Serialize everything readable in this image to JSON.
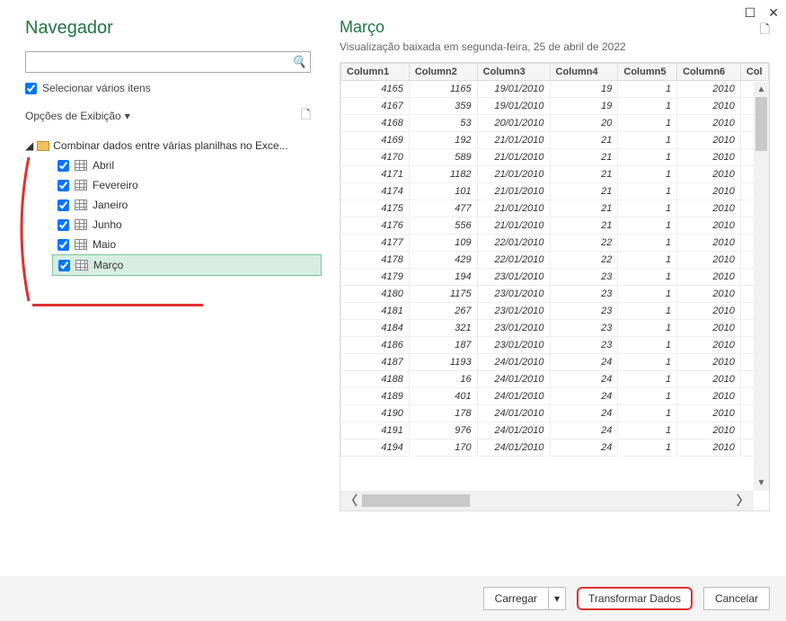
{
  "window": {
    "title": "Navegador"
  },
  "search": {
    "placeholder": ""
  },
  "selectMultiple": {
    "label": "Selecionar vários itens",
    "checked": true
  },
  "displayOptions": {
    "label": "Opções de Exibição"
  },
  "tree": {
    "root": "Combinar dados entre várias planilhas no Exce...",
    "items": [
      {
        "label": "Abril",
        "checked": true,
        "selected": false
      },
      {
        "label": "Fevereiro",
        "checked": true,
        "selected": false
      },
      {
        "label": "Janeiro",
        "checked": true,
        "selected": false
      },
      {
        "label": "Junho",
        "checked": true,
        "selected": false
      },
      {
        "label": "Maio",
        "checked": true,
        "selected": false
      },
      {
        "label": "Março",
        "checked": true,
        "selected": true
      }
    ]
  },
  "preview": {
    "title": "Março",
    "subtitle": "Visualização baixada em segunda-feira, 25 de abril de 2022",
    "columns": [
      "Column1",
      "Column2",
      "Column3",
      "Column4",
      "Column5",
      "Column6",
      "Col"
    ],
    "rows": [
      [
        "4165",
        "1165",
        "19/01/2010",
        "19",
        "1",
        "2010"
      ],
      [
        "4167",
        "359",
        "19/01/2010",
        "19",
        "1",
        "2010"
      ],
      [
        "4168",
        "53",
        "20/01/2010",
        "20",
        "1",
        "2010"
      ],
      [
        "4169",
        "192",
        "21/01/2010",
        "21",
        "1",
        "2010"
      ],
      [
        "4170",
        "589",
        "21/01/2010",
        "21",
        "1",
        "2010"
      ],
      [
        "4171",
        "1182",
        "21/01/2010",
        "21",
        "1",
        "2010"
      ],
      [
        "4174",
        "101",
        "21/01/2010",
        "21",
        "1",
        "2010"
      ],
      [
        "4175",
        "477",
        "21/01/2010",
        "21",
        "1",
        "2010"
      ],
      [
        "4176",
        "556",
        "21/01/2010",
        "21",
        "1",
        "2010"
      ],
      [
        "4177",
        "109",
        "22/01/2010",
        "22",
        "1",
        "2010"
      ],
      [
        "4178",
        "429",
        "22/01/2010",
        "22",
        "1",
        "2010"
      ],
      [
        "4179",
        "194",
        "23/01/2010",
        "23",
        "1",
        "2010"
      ],
      [
        "4180",
        "1175",
        "23/01/2010",
        "23",
        "1",
        "2010"
      ],
      [
        "4181",
        "267",
        "23/01/2010",
        "23",
        "1",
        "2010"
      ],
      [
        "4184",
        "321",
        "23/01/2010",
        "23",
        "1",
        "2010"
      ],
      [
        "4186",
        "187",
        "23/01/2010",
        "23",
        "1",
        "2010"
      ],
      [
        "4187",
        "1193",
        "24/01/2010",
        "24",
        "1",
        "2010"
      ],
      [
        "4188",
        "16",
        "24/01/2010",
        "24",
        "1",
        "2010"
      ],
      [
        "4189",
        "401",
        "24/01/2010",
        "24",
        "1",
        "2010"
      ],
      [
        "4190",
        "178",
        "24/01/2010",
        "24",
        "1",
        "2010"
      ],
      [
        "4191",
        "976",
        "24/01/2010",
        "24",
        "1",
        "2010"
      ],
      [
        "4194",
        "170",
        "24/01/2010",
        "24",
        "1",
        "2010"
      ]
    ]
  },
  "footer": {
    "load": "Carregar",
    "transform": "Transformar Dados",
    "cancel": "Cancelar"
  }
}
